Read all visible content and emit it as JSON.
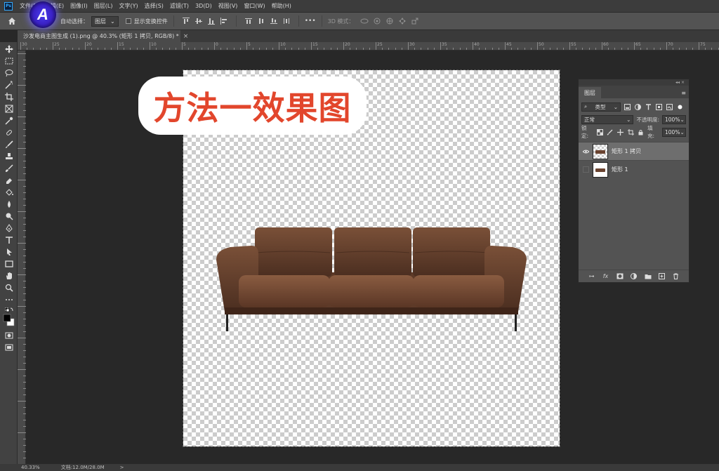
{
  "app": {
    "logo_text": "Ps",
    "badge_letter": "A"
  },
  "menu": [
    "文件(F)",
    "编辑(E)",
    "图像(I)",
    "图层(L)",
    "文字(Y)",
    "选择(S)",
    "滤镜(T)",
    "3D(D)",
    "视图(V)",
    "窗口(W)",
    "帮助(H)"
  ],
  "options": {
    "auto_select_label": "自动选择：",
    "auto_select_value": "图层",
    "show_transform_label": "显示变换控件",
    "more_label": "•••",
    "mode_label": "3D 模式："
  },
  "document_tab": {
    "title": "沙发电商主图生成 (1).png @ 40.3% (矩形 1 拷贝, RGB/8) *",
    "close": "×"
  },
  "ruler_numbers": [
    "30",
    "25",
    "20",
    "15",
    "10",
    "5",
    "0",
    "5",
    "10",
    "15",
    "20",
    "25",
    "30",
    "35",
    "40",
    "45",
    "50",
    "55",
    "60",
    "65",
    "70",
    "75"
  ],
  "canvas": {
    "overlay_text": "方法一效果图"
  },
  "layers_panel": {
    "title": "图层",
    "filter_label": "类型",
    "blend_mode": "正常",
    "opacity_label": "不透明度:",
    "opacity_value": "100%",
    "lock_label": "锁定:",
    "fill_label": "填充:",
    "fill_value": "100%",
    "layers": [
      {
        "name": "矩形 1 拷贝",
        "visible": true,
        "selected": true
      },
      {
        "name": "矩形 1",
        "visible": false,
        "selected": false
      }
    ],
    "footer_icons": [
      "link-icon",
      "fx-icon",
      "mask-icon",
      "adjustment-icon",
      "group-icon",
      "new-layer-icon",
      "trash-icon"
    ]
  },
  "status": {
    "zoom": "40.33%",
    "doc_info": "文档:12.0M/28.0M",
    "arrow": ">"
  },
  "colors": {
    "overlay_text": "#e2462c",
    "accent": "#31a8ff"
  }
}
